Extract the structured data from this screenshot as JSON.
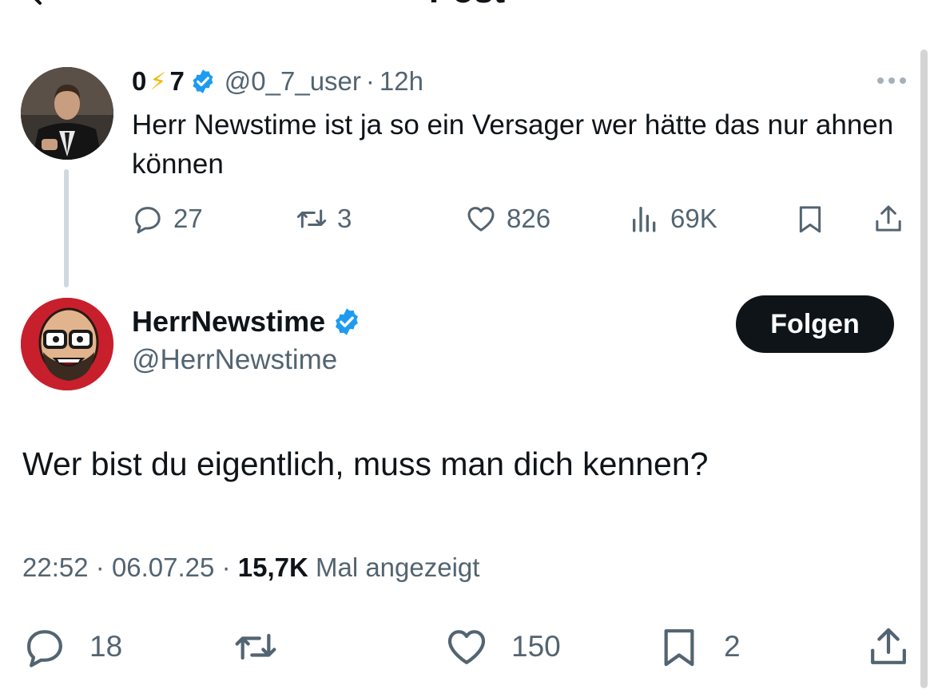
{
  "header": {
    "title": "Post",
    "back_icon": "arrow-left-icon"
  },
  "parent_tweet": {
    "display_name_left": "0",
    "display_name_emoji": "⚡",
    "display_name_right": "7",
    "handle": "@0_7_user",
    "separator": "·",
    "time": "12h",
    "text": "Herr Newstime ist ja so ein Versager wer hätte das nur ahnen können",
    "replies": "27",
    "reposts": "3",
    "likes": "826",
    "views": "69K"
  },
  "main_tweet": {
    "display_name": "HerrNewstime",
    "handle": "@HerrNewstime",
    "follow_label": "Folgen",
    "text": "Wer bist du eigentlich, muss man dich kennen?",
    "time": "22:52",
    "date": "06.07.25",
    "separator": "·",
    "views_count": "15,7K",
    "views_label": "Mal angezeigt",
    "replies": "18",
    "likes": "150",
    "bookmarks": "2"
  },
  "colors": {
    "verified": "#1d9bf0",
    "secondary_text": "#536471",
    "primary_text": "#0f1419",
    "bolt": "#f5b70a"
  }
}
